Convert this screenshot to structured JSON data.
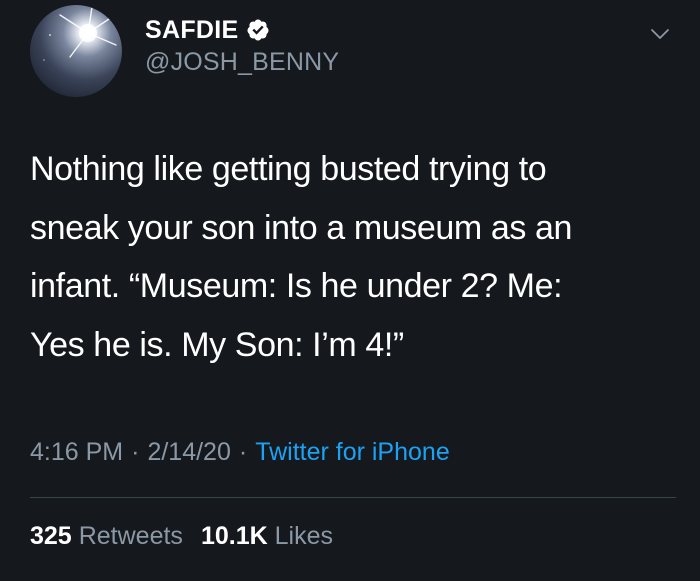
{
  "author": {
    "display_name": "SAFDIE",
    "handle": "@JOSH_BENNY",
    "verified": true,
    "avatar_icon": "avatar-image"
  },
  "menu": {
    "icon": "chevron-down-icon"
  },
  "tweet": {
    "text": "Nothing like getting busted trying to sneak your son into a museum as an infant. “Museum: Is he under 2? Me: Yes he is. My Son: I’m 4!”",
    "lines": [
      "Nothing like getting busted trying to",
      "sneak your son into a museum as an",
      "infant. “Museum: Is he under 2? Me:",
      "Yes he is. My Son: I’m 4!”"
    ]
  },
  "meta": {
    "time": "4:16 PM",
    "date": "2/14/20",
    "separator": "·",
    "source": "Twitter for iPhone"
  },
  "stats": {
    "retweets_count": "325",
    "retweets_label": "Retweets",
    "likes_count": "10.1K",
    "likes_label": "Likes"
  },
  "colors": {
    "background": "#15181d",
    "primary_text": "#ffffff",
    "secondary_text": "#8b98a5",
    "link": "#1da1f2",
    "divider": "#38444d"
  }
}
